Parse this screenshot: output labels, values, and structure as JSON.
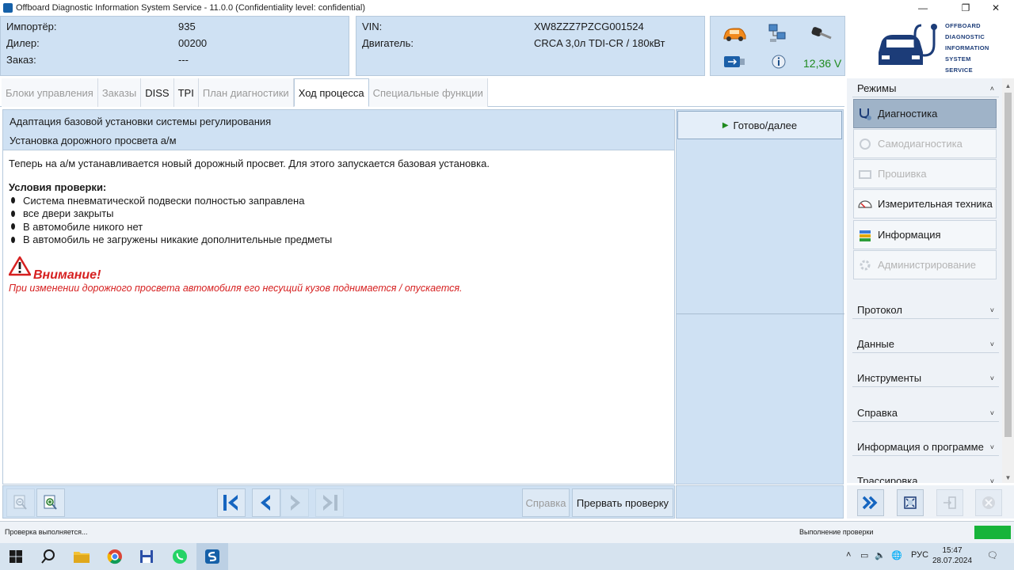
{
  "window": {
    "title": "Offboard Diagnostic Information System Service - 11.0.0 (Confidentiality level: confidential)",
    "controls": [
      "—",
      "❐",
      "✕"
    ]
  },
  "header": {
    "importer_label": "Импортёр:",
    "importer_value": "935",
    "dealer_label": "Дилер:",
    "dealer_value": "00200",
    "order_label": "Заказ:",
    "order_value": "---",
    "vin_label": "VIN:",
    "vin_value": "XW8ZZZ7PZCG001524",
    "engine_label": "Двигатель:",
    "engine_value": "CRCA 3,0л TDI-CR / 180кВт",
    "voltage": "12,36 V"
  },
  "logo": {
    "lines": [
      "OFFBOARD",
      "DIAGNOSTIC",
      "INFORMATION",
      "SYSTEM",
      "SERVICE"
    ]
  },
  "tabs": [
    {
      "label": "Блоки управления",
      "state": "disabled"
    },
    {
      "label": "Заказы",
      "state": "disabled"
    },
    {
      "label": "DISS",
      "state": "enabled"
    },
    {
      "label": "TPI",
      "state": "enabled"
    },
    {
      "label": "План диагностики",
      "state": "disabled"
    },
    {
      "label": "Ход процесса",
      "state": "active"
    },
    {
      "label": "Специальные функции",
      "state": "disabled"
    }
  ],
  "procedure": {
    "title": "Адаптация базовой установки системы регулирования",
    "subtitle": "Установка дорожного просвета а/м",
    "intro": "Теперь на а/м устанавливается новый дорожный просвет. Для этого запускается базовая установка.",
    "conditions_title": "Условия проверки:",
    "conditions": [
      "Система пневматической подвески полностью заправлена",
      "все двери закрыты",
      "В автомобиле никого нет",
      "В автомобиль не загружены никакие дополнительные предметы"
    ],
    "warning_title": "Внимание!",
    "warning_text": "При изменении дорожного просвета автомобиля его несущий кузов поднимается / опускается."
  },
  "actions": {
    "ready_label": "Готово/далее"
  },
  "toolbar": {
    "help_label": "Справка",
    "abort_label": "Прервать проверку"
  },
  "sidebar": {
    "modes_title": "Режимы",
    "modes": [
      {
        "label": "Диагностика",
        "state": "active",
        "icon": "stethoscope-icon"
      },
      {
        "label": "Самодиагностика",
        "state": "disabled",
        "icon": "self-diagnosis-icon"
      },
      {
        "label": "Прошивка",
        "state": "disabled",
        "icon": "flash-icon"
      },
      {
        "label": "Измерительная техника",
        "state": "enabled",
        "icon": "gauge-icon"
      },
      {
        "label": "Информация",
        "state": "enabled",
        "icon": "books-icon"
      },
      {
        "label": "Администрирование",
        "state": "disabled",
        "icon": "admin-icon"
      }
    ],
    "sections": [
      "Протокол",
      "Данные",
      "Инструменты",
      "Справка",
      "Информация о программе",
      "Трассировка"
    ]
  },
  "status": {
    "left_text": "Проверка выполняется...",
    "right_text": "Выполнение проверки",
    "progress": 1.0,
    "progress_color": "#17b43a"
  },
  "taskbar": {
    "language": "РУС",
    "time": "15:47",
    "date": "28.07.2024"
  },
  "colors": {
    "panel_blue": "#cfe1f3",
    "warning_red": "#d62020",
    "voltage_green": "#1f8a1f",
    "nav_blue": "#1565c0"
  }
}
